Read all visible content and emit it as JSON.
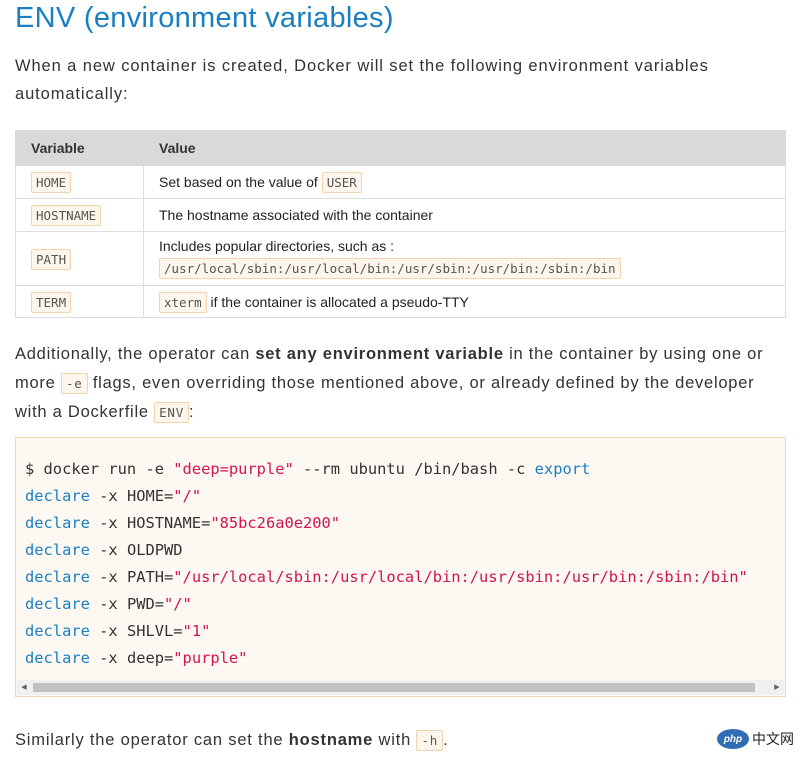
{
  "heading": "ENV (environment variables)",
  "intro": "When a new container is created, Docker will set the following environment variables automatically:",
  "table": {
    "headers": [
      "Variable",
      "Value"
    ],
    "rows": [
      {
        "var": "HOME",
        "value_text": "Set based on the value of",
        "value_code": "USER"
      },
      {
        "var": "HOSTNAME",
        "value_text": "The hostname associated with the container"
      },
      {
        "var": "PATH",
        "value_text": "Includes popular directories, such as :",
        "value_code": "/usr/local/sbin:/usr/local/bin:/usr/sbin:/usr/bin:/sbin:/bin"
      },
      {
        "var": "TERM",
        "value_code": "xterm",
        "value_text": "if the container is allocated a pseudo-TTY"
      }
    ]
  },
  "para2": {
    "t1": "Additionally, the operator can ",
    "bold": "set any environment variable",
    "t2": " in the container by using one or more ",
    "code1": "-e",
    "t3": " flags, even overriding those mentioned above, or already defined by the developer with a Dockerfile ",
    "code2": "ENV",
    "t4": ":"
  },
  "code_block": {
    "line1": {
      "a": "$ docker run -e ",
      "s": "\"deep=purple\"",
      "b": " --rm ubuntu /bin/bash -c ",
      "k": "export"
    },
    "declare_kw": "declare",
    "lines": [
      {
        "mid": " -x HOME=",
        "str": "\"/\""
      },
      {
        "mid": " -x HOSTNAME=",
        "str": "\"85bc26a0e200\""
      },
      {
        "mid": " -x OLDPWD",
        "str": ""
      },
      {
        "mid": " -x PATH=",
        "str": "\"/usr/local/sbin:/usr/local/bin:/usr/sbin:/usr/bin:/sbin:/bin\""
      },
      {
        "mid": " -x PWD=",
        "str": "\"/\""
      },
      {
        "mid": " -x SHLVL=",
        "str": "\"1\""
      },
      {
        "mid": " -x deep=",
        "str": "\"purple\""
      }
    ]
  },
  "para3": {
    "t1": "Similarly the operator can set the ",
    "bold": "hostname",
    "t2": " with ",
    "code": "-h",
    "t3": "."
  },
  "watermark": {
    "logo": "php",
    "text": "中文网"
  },
  "colors": {
    "heading": "#1a7fc1",
    "keyword": "#1a7fc1",
    "string": "#d2164b",
    "code_bg": "#fdf8f1",
    "code_border": "#f3d7b4"
  }
}
